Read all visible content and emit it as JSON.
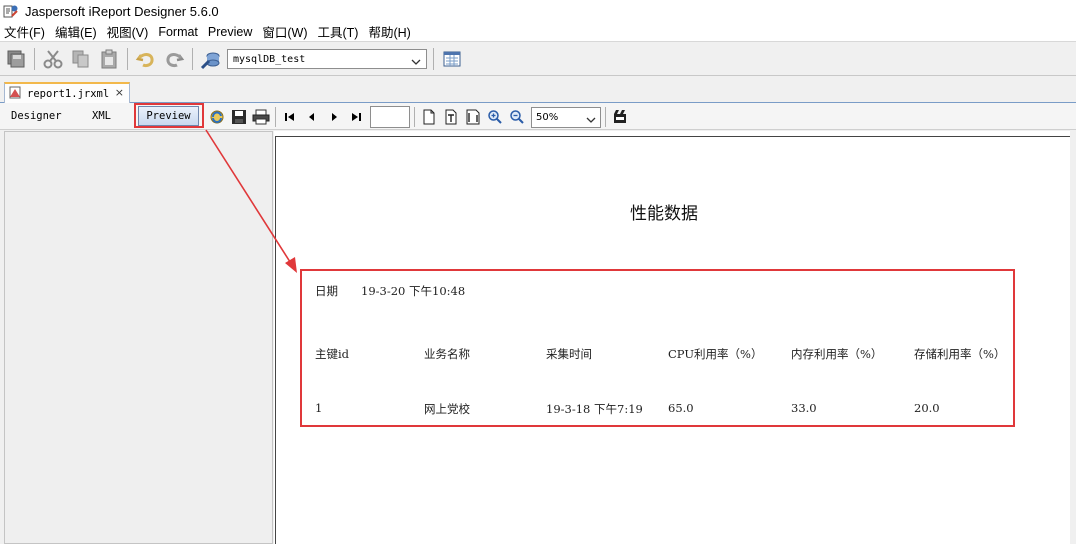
{
  "window": {
    "title": "Jaspersoft iReport Designer 5.6.0"
  },
  "menu": [
    "文件(F)",
    "编辑(E)",
    "视图(V)",
    "Format",
    "Preview",
    "窗口(W)",
    "工具(T)",
    "帮助(H)"
  ],
  "toolbar": {
    "datasource": "mysqlDB_test",
    "icons": [
      "save-all-icon",
      "cut-icon",
      "copy-icon",
      "paste-icon",
      "undo-icon",
      "redo-icon",
      "datasource-icon",
      "query-icon"
    ]
  },
  "document_tab": {
    "label": "report1.jrxml",
    "close": "×"
  },
  "view_tabs": {
    "designer": "Designer",
    "xml": "XML",
    "preview": "Preview"
  },
  "preview_toolbar": {
    "zoom": "50%",
    "page_number": ""
  },
  "report": {
    "title": "性能数据",
    "date_label": "日期",
    "date_value": "19-3-20  下午10:48",
    "headers": [
      "主键id",
      "业务名称",
      "采集时间",
      "CPU利用率（%）",
      "内存利用率（%）",
      "存储利用率（%）"
    ],
    "row": [
      "1",
      "网上党校",
      "19-3-18  下午7:19",
      "65.0",
      "33.0",
      "20.0"
    ]
  },
  "colors": {
    "annotation_red": "#e0383a",
    "tab_accent": "#f2b84b"
  }
}
